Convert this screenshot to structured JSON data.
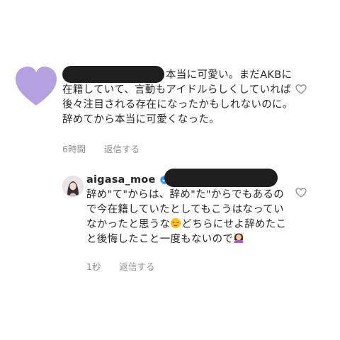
{
  "comment": {
    "text": "本当に可愛い。まだAKBに在籍していて、言動もアイドルらしくしていれば後々注目される存在になったかもしれないのに。辞めてから本当に可愛くなった。",
    "time": "6時間",
    "reply_label": "返信する",
    "avatar_icon": "heart-icon",
    "avatar_color": "#b4a2e0"
  },
  "reply": {
    "username": "aigasa_moe",
    "verified_icon": "verified-badge-icon",
    "text_part1": "辞め\"て\"からは、辞め\"た\"からでもあるので今在籍していたとしてもこうはなっていなかったと思うな",
    "emoji1": "relieved-face-emoji",
    "text_part2": "どちらにせよ辞めたこと後悔したこと一度もないので",
    "emoji2": "person-gesturing-ok-emoji",
    "time": "1秒",
    "reply_label": "返信する"
  },
  "like_icon": "heart-outline-icon",
  "accent_color": "#3897f0"
}
